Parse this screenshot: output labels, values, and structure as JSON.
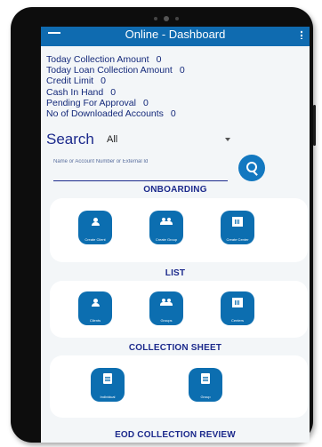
{
  "appbar": {
    "title": "Online - Dashboard"
  },
  "stats": [
    {
      "label": "Today Collection Amount",
      "value": "0"
    },
    {
      "label": "Today Loan Collection Amount",
      "value": "0"
    },
    {
      "label": "Credit Limit",
      "value": "0"
    },
    {
      "label": "Cash In Hand",
      "value": "0"
    },
    {
      "label": "Pending For Approval",
      "value": "0"
    },
    {
      "label": "No of Downloaded Accounts",
      "value": "0"
    }
  ],
  "search": {
    "label": "Search",
    "filter": "All",
    "placeholder": "Name or Account Number or External Id"
  },
  "sections": {
    "onboarding": {
      "title": "ONBOARDING",
      "tiles": [
        "Create Client",
        "Create Group",
        "Create Center"
      ]
    },
    "list": {
      "title": "LIST",
      "tiles": [
        "Clients",
        "Groups",
        "Centers"
      ]
    },
    "collection_sheet": {
      "title": "COLLECTION SHEET",
      "tiles": [
        "Individual",
        "Group"
      ]
    },
    "eod": {
      "title": "EOD COLLECTION REVIEW"
    }
  },
  "colors": {
    "primary": "#0f6bb0",
    "heading": "#1c2a8c",
    "background": "#f3f6f8"
  }
}
